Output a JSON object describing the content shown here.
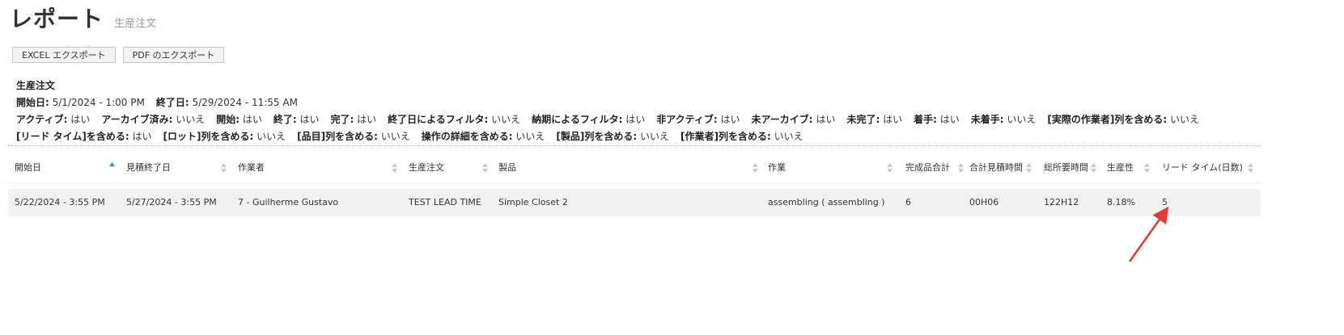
{
  "page": {
    "title": "レポート",
    "subtitle": "生産注文"
  },
  "toolbar": {
    "excel_export_label": "EXCEL エクスポート",
    "pdf_export_label": "PDF のエクスポート"
  },
  "filters": {
    "section_title": "生産注文",
    "date_row": [
      {
        "key": "開始日:",
        "value": "5/1/2024 - 1:00 PM"
      },
      {
        "key": "終了日:",
        "value": "5/29/2024 - 11:55 AM"
      }
    ],
    "flags_row1": [
      {
        "key": "アクティブ:",
        "value": "はい"
      },
      {
        "key": "アーカイブ済み:",
        "value": "いいえ"
      },
      {
        "key": "開始:",
        "value": "はい"
      },
      {
        "key": "終了:",
        "value": "はい"
      },
      {
        "key": "完了:",
        "value": "はい"
      },
      {
        "key": "終了日によるフィルタ:",
        "value": "いいえ"
      },
      {
        "key": "納期によるフィルタ:",
        "value": "はい"
      },
      {
        "key": "非アクティブ:",
        "value": "はい"
      },
      {
        "key": "未アーカイブ:",
        "value": "はい"
      },
      {
        "key": "未完了:",
        "value": "はい"
      },
      {
        "key": "着手:",
        "value": "はい"
      },
      {
        "key": "未着手:",
        "value": "いいえ"
      },
      {
        "key": "[実際の作業者]列を含める:",
        "value": "いいえ"
      }
    ],
    "flags_row2": [
      {
        "key": "[リード タイム]を含める:",
        "value": "はい"
      },
      {
        "key": "[ロット]列を含める:",
        "value": "いいえ"
      },
      {
        "key": "[品目]列を含める:",
        "value": "いいえ"
      },
      {
        "key": "操作の詳細を含める:",
        "value": "いいえ"
      },
      {
        "key": "[製品]列を含める:",
        "value": "いいえ"
      },
      {
        "key": "[作業者]列を含める:",
        "value": "いいえ"
      }
    ]
  },
  "table": {
    "columns": [
      "開始日",
      "見積終了日",
      "作業者",
      "生産注文",
      "製品",
      "作業",
      "完成品合計",
      "合計見積時間",
      "総所要時間",
      "生産性",
      "リード タイム(日数)"
    ],
    "rows": [
      [
        "5/22/2024 - 3:55 PM",
        "5/27/2024 - 3:55 PM",
        "7 - Guilherme Gustavo",
        "TEST LEAD TIME",
        "Simple Closet 2",
        "assembling ( assembling )",
        "6",
        "00H06",
        "122H12",
        "8.18%",
        "5"
      ]
    ],
    "sorted_column": "開始日",
    "sort_direction": "ascending"
  },
  "colors": {
    "sort_active": "#1a9bd7",
    "annotation_arrow": "#e53935",
    "row_background": "#f2f2f2"
  }
}
